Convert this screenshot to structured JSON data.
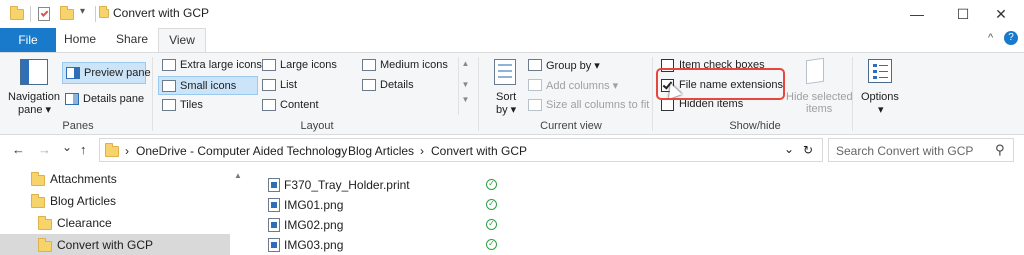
{
  "window": {
    "title": "Convert with GCP",
    "minimize_glyph": "—",
    "maximize_glyph": "☐",
    "close_glyph": "✕"
  },
  "ribbon_tabs": [
    {
      "label": "File"
    },
    {
      "label": "Home"
    },
    {
      "label": "Share"
    },
    {
      "label": "View"
    }
  ],
  "ribbon_controls": {
    "collapse_glyph": "^",
    "help_glyph": "?"
  },
  "panes_group": {
    "label": "Panes",
    "navigation_pane": "Navigation",
    "navigation_pane_sub": "pane ▾",
    "preview_pane": "Preview pane",
    "details_pane": "Details pane"
  },
  "layout_group": {
    "label": "Layout",
    "items": [
      "Extra large icons",
      "Large icons",
      "Medium icons",
      "Small icons",
      "List",
      "Details",
      "Tiles",
      "Content"
    ],
    "selected": "Small icons"
  },
  "current_view_group": {
    "label": "Current view",
    "sort_by": "Sort",
    "sort_by_sub": "by ▾",
    "group_by": "Group by ▾",
    "add_columns": "Add columns ▾",
    "size_all_columns": "Size all columns to fit"
  },
  "show_hide_group": {
    "label": "Show/hide",
    "item_check_boxes": "Item check boxes",
    "item_check_boxes_checked": false,
    "file_name_extensions": "File name extensions",
    "file_name_extensions_checked": true,
    "hidden_items": "Hidden items",
    "hidden_items_checked": false,
    "hide_selected": "Hide selected",
    "hide_selected_sub": "items"
  },
  "options": {
    "label": "Options",
    "sub": "▾"
  },
  "address_bar": {
    "back": "←",
    "forward": "→",
    "recent": "⌄",
    "up": "↑",
    "breadcrumb": [
      "OneDrive - Computer Aided Technology",
      "Blog Articles",
      "Convert with GCP"
    ],
    "separator": "›",
    "dropdown": "⌄",
    "refresh": "↻"
  },
  "search": {
    "placeholder": "Search Convert with GCP",
    "icon": "⚲"
  },
  "nav_pane": {
    "items": [
      {
        "label": "Attachments",
        "indent": 0
      },
      {
        "label": "Blog Articles",
        "indent": 0
      },
      {
        "label": "Clearance",
        "indent": 1
      },
      {
        "label": "Convert with GCP",
        "indent": 1,
        "selected": true
      }
    ],
    "scroll_up": "▲"
  },
  "files": [
    {
      "name": "F370_Tray_Holder.print",
      "status": "✓"
    },
    {
      "name": "IMG01.png",
      "status": "✓"
    },
    {
      "name": "IMG02.png",
      "status": "✓"
    },
    {
      "name": "IMG03.png",
      "status": "✓"
    }
  ],
  "colors": {
    "accent": "#1979ca",
    "highlight": "#cce4f7",
    "callout": "#e8453c",
    "sync_ok": "#2ea043",
    "folder": "#f6d36b"
  }
}
